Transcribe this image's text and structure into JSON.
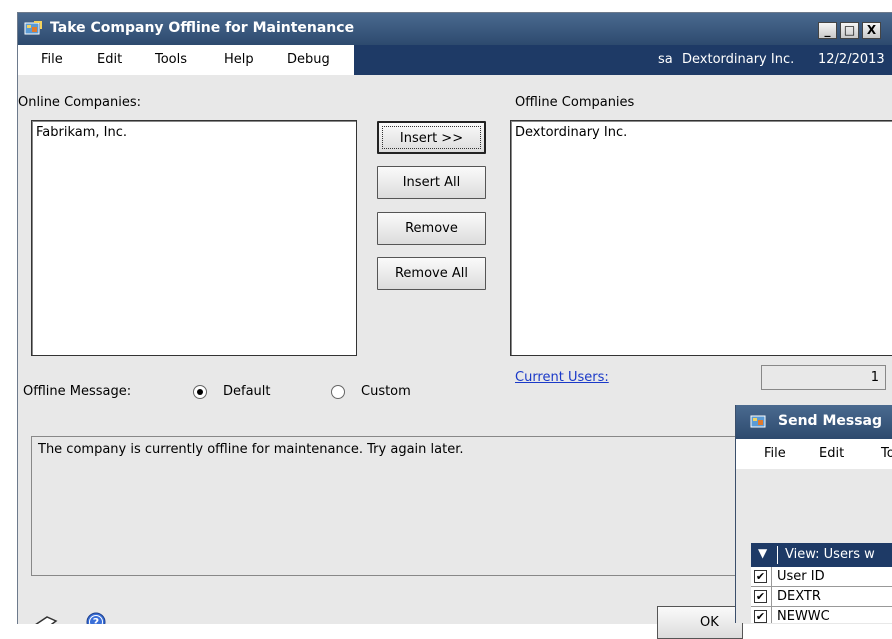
{
  "window": {
    "title": "Take Company Offline for Maintenance",
    "minimize_glyph": "_",
    "maximize_glyph": "□",
    "close_glyph": "X"
  },
  "menu": [
    "File",
    "Edit",
    "Tools",
    "Help",
    "Debug"
  ],
  "status": {
    "user": "sa",
    "company": "Dextordinary Inc.",
    "date": "12/2/2013"
  },
  "online": {
    "label": "Online Companies:",
    "items": [
      "Fabrikam, Inc."
    ]
  },
  "offline": {
    "label": "Offline Companies",
    "items": [
      "Dextordinary Inc."
    ]
  },
  "buttons": {
    "insert": "Insert >>",
    "insert_all": "Insert All",
    "remove": "Remove",
    "remove_all": "Remove All"
  },
  "current_users": {
    "label": "Current Users:",
    "value": "1"
  },
  "offline_message": {
    "label": "Offline Message:",
    "options": [
      "Default",
      "Custom"
    ],
    "selected": "Default",
    "text": "The company is currently offline for maintenance. Try again later."
  },
  "footer": {
    "ok": "OK"
  },
  "send_message_window": {
    "title": "Send Messag",
    "menu": [
      "File",
      "Edit",
      "To"
    ],
    "grid_header": "View: Users w",
    "column_user_id": "User ID",
    "rows": [
      {
        "user": "DEXTR",
        "checked": true
      },
      {
        "user": "NEWWC",
        "checked": true
      }
    ]
  },
  "colors": {
    "titlebar": "#2d4a6e",
    "status_bar": "#1e3a66",
    "link": "#1a39c8"
  },
  "icons": [
    "app-icon",
    "note-icon",
    "help-icon",
    "dropdown-arrow-icon",
    "checkbox-icon"
  ]
}
